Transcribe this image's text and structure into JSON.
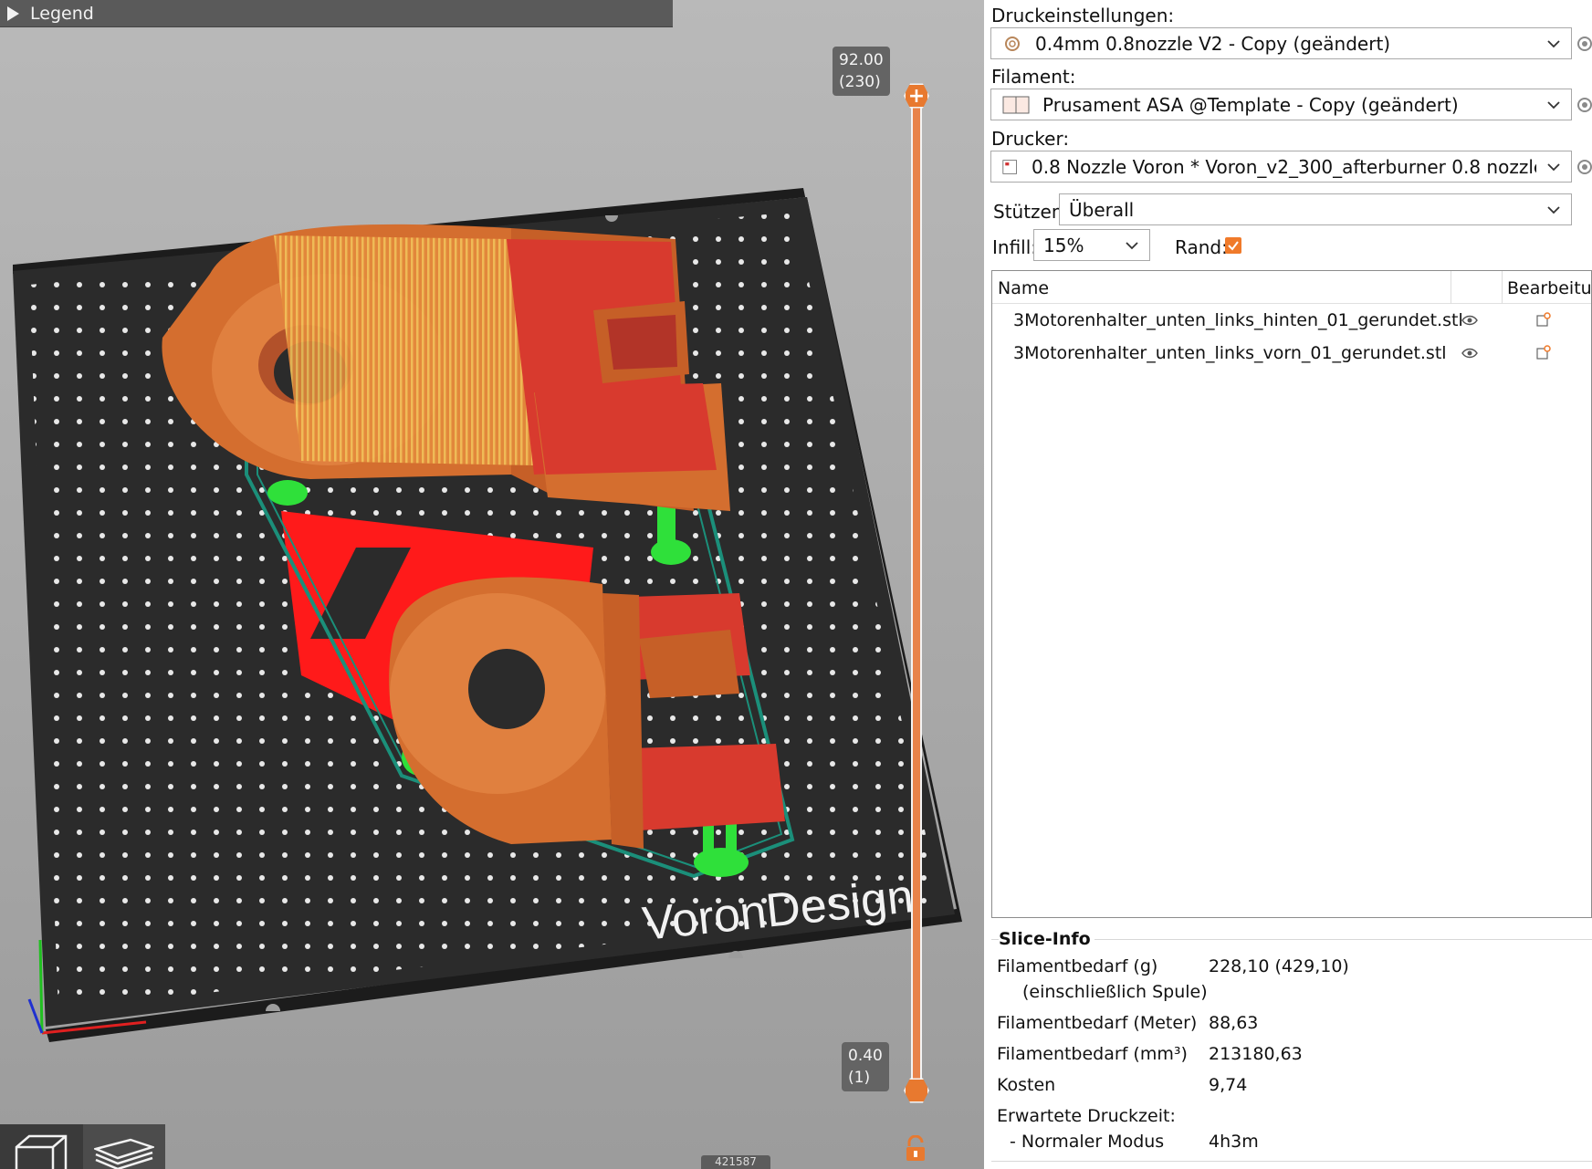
{
  "viewport": {
    "legend_label": "Legend",
    "slider_top_value": "92.00",
    "slider_top_layer": "(230)",
    "slider_bottom_value": "0.40",
    "slider_bottom_layer": "(1)",
    "bed_logo_text": "VoronDesign",
    "bottom_counter": "421587",
    "slider_color": "#e8792f",
    "bed_color": "#2b2b2b",
    "model_color": "#e07b3c",
    "top_surface_color": "#d83a2e",
    "support_color": "#2fe03a",
    "skirt_color": "#1b8f7a",
    "icons": [
      "play-triangle-icon",
      "plus-icon",
      "hexagon-handle-icon",
      "unlock-icon",
      "3d-view-icon",
      "layers-view-icon",
      "axes-icon"
    ]
  },
  "panel": {
    "print_settings_label": "Druckeinstellungen:",
    "print_settings_value": "0.4mm 0.8nozzle V2 - Copy (geändert)",
    "filament_label": "Filament:",
    "filament_value": "Prusament ASA @Template - Copy (geändert)",
    "printer_label": "Drucker:",
    "printer_value": "0.8 Nozzle Voron  * Voron_v2_300_afterburner 0.8 nozzle - 1. ...",
    "supports_label": "Stützen:",
    "supports_value": "Überall",
    "infill_label": "Infill:",
    "infill_value": "15%",
    "brim_label": "Rand:",
    "brim_checked": true,
    "accent_color": "#f07a2a",
    "objects": {
      "col_name": "Name",
      "col_edit": "Bearbeitu...",
      "rows": [
        {
          "name": "3Motorenhalter_unten_links_hinten_01_gerundet.stl"
        },
        {
          "name": "3Motorenhalter_unten_links_vorn_01_gerundet.stl"
        }
      ]
    },
    "slice_info": {
      "title": "Slice-Info",
      "filament_g_label": "Filamentbedarf (g)",
      "filament_g_sub": "(einschließlich Spule)",
      "filament_g_value": "228,10 (429,10)",
      "filament_m_label": "Filamentbedarf (Meter)",
      "filament_m_value": "88,63",
      "filament_mm3_label": "Filamentbedarf (mm³)",
      "filament_mm3_value": "213180,63",
      "cost_label": "Kosten",
      "cost_value": "9,74",
      "time_label": "Erwartete Druckzeit:",
      "mode_label": "- Normaler Modus",
      "mode_value": "4h3m"
    }
  }
}
